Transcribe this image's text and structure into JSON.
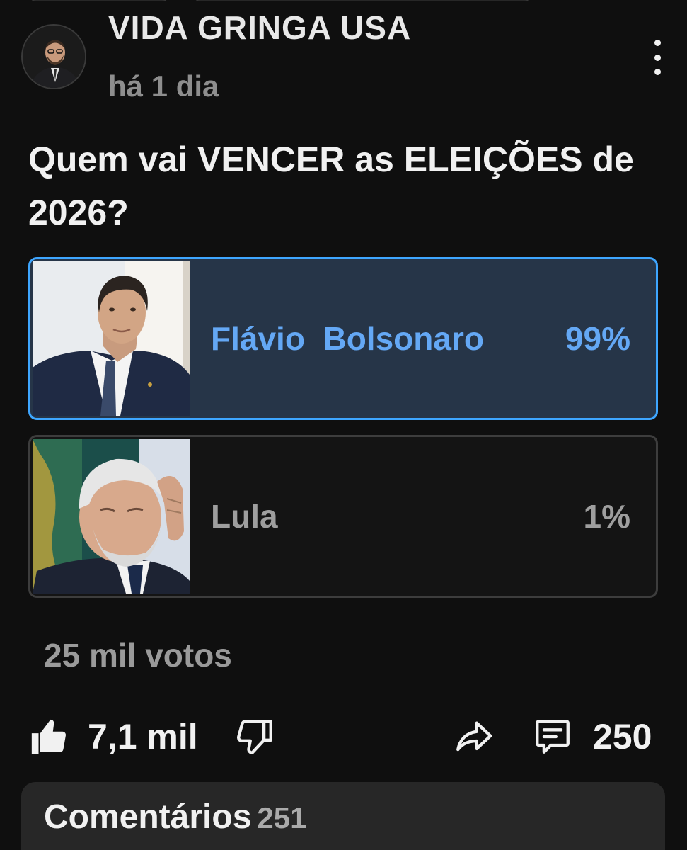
{
  "post": {
    "channel_name": "VIDA GRINGA USA",
    "timestamp": "há 1 dia",
    "question": "Quem vai VENCER as ELEIÇÕES de 2026?"
  },
  "poll": {
    "options": [
      {
        "label": "Flávio  Bolsonaro",
        "percent": "99%",
        "percent_value": 99,
        "selected": true,
        "photo": "person-suit-photo"
      },
      {
        "label": "Lula",
        "percent": "1%",
        "percent_value": 1,
        "selected": false,
        "photo": "person-gray-hair-photo"
      }
    ],
    "votes": "25 mil votos"
  },
  "actions": {
    "like_count": "7,1 mil",
    "like_icon": "thumbs-up-icon",
    "dislike_icon": "thumbs-down-icon",
    "share_icon": "share-icon",
    "comment_icon": "comment-icon",
    "comment_count": "250"
  },
  "comments_section": {
    "title": "Comentários",
    "count": "251"
  },
  "colors": {
    "background": "#0f0f0f",
    "selected_border": "#3ea6ff",
    "selected_fill": "#263548",
    "selected_text": "#64a8f5"
  }
}
